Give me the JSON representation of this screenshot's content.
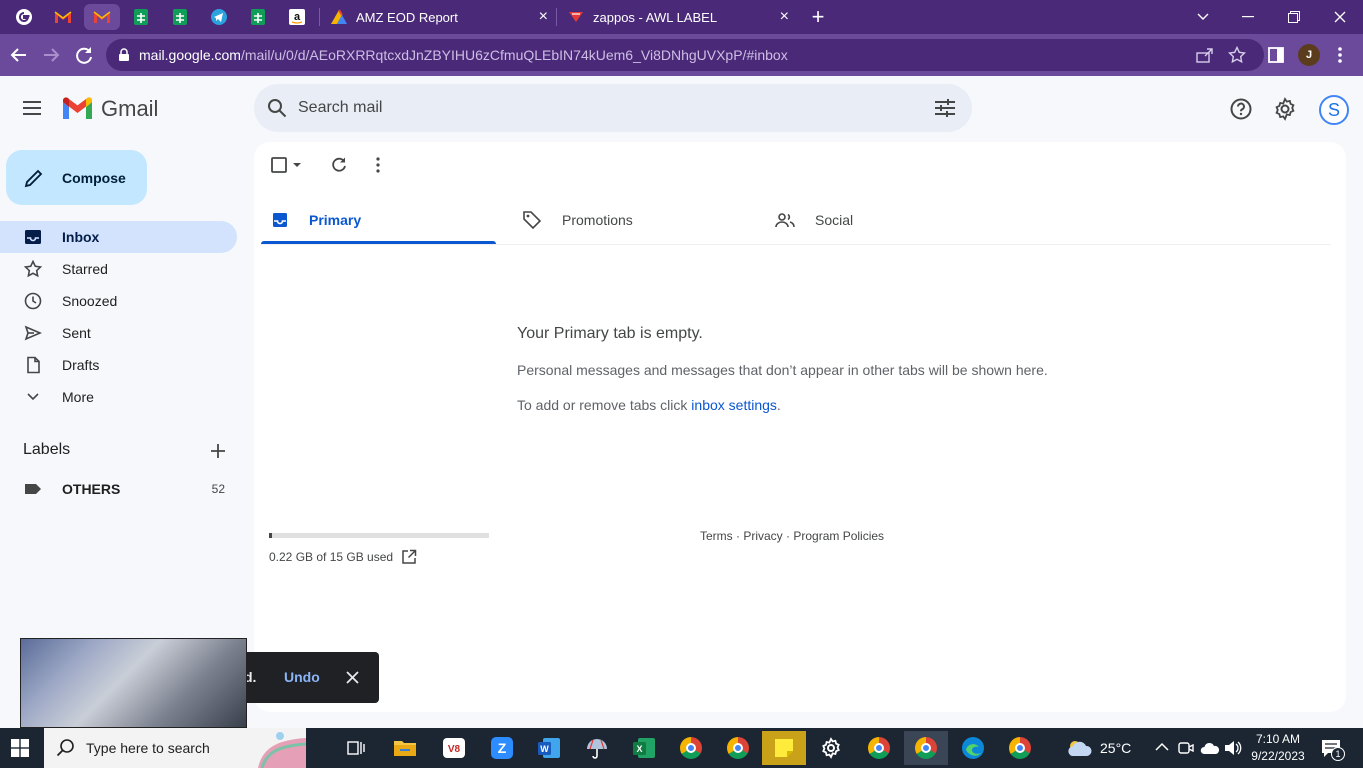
{
  "browser": {
    "tabs": [
      {
        "title": "AMZ EOD Report",
        "close": "×"
      },
      {
        "title": "zappos - AWL LABEL",
        "close": "×"
      }
    ],
    "new_tab": "+",
    "url_host": "mail.google.com",
    "url_path": "/mail/u/0/d/AEoRXRRqtcxdJnZBYIHU6zCfmuQLEbIN74kUem6_Vi8DNhgUVXpP/#inbox",
    "profile_initial": "J"
  },
  "gmail": {
    "logo_text": "Gmail",
    "search_placeholder": "Search mail",
    "avatar_initial": "S",
    "compose_label": "Compose",
    "nav": [
      {
        "label": "Inbox"
      },
      {
        "label": "Starred"
      },
      {
        "label": "Snoozed"
      },
      {
        "label": "Sent"
      },
      {
        "label": "Drafts"
      },
      {
        "label": "More"
      }
    ],
    "labels_heading": "Labels",
    "labels": [
      {
        "name": "OTHERS",
        "count": "52"
      }
    ],
    "tabs": [
      {
        "label": "Primary"
      },
      {
        "label": "Promotions"
      },
      {
        "label": "Social"
      }
    ],
    "empty": {
      "title": "Your Primary tab is empty.",
      "line1": "Personal messages and messages that don’t appear in other tabs will be shown here.",
      "line2_prefix": "To add or remove tabs click ",
      "line2_link": "inbox settings",
      "line2_suffix": "."
    },
    "storage": {
      "text": "0.22 GB of 15 GB used",
      "fraction": 0.015
    },
    "footer": {
      "terms": "Terms",
      "privacy": "Privacy",
      "policies": "Program Policies",
      "sep": " · "
    },
    "snackbar": {
      "text": "d.",
      "undo": "Undo"
    }
  },
  "taskbar": {
    "search_placeholder": "Type here to search",
    "weather": "25°C",
    "time": "7:10 AM",
    "date": "9/22/2023",
    "notification_count": "1"
  },
  "colors": {
    "tabstrip": "#4a2a78",
    "toolbar": "#6b4a9b",
    "gmail_blue": "#0b57d0",
    "compose_bg": "#c2e7ff",
    "inbox_active": "#d3e3fd"
  }
}
